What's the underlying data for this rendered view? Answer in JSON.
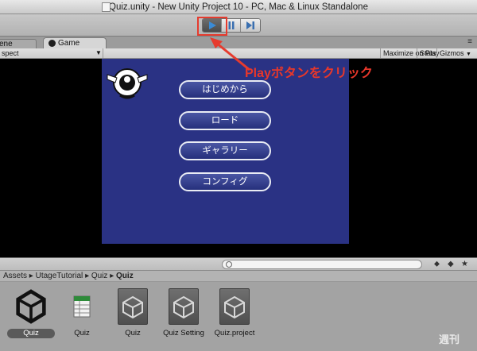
{
  "window": {
    "title": "Quiz.unity - New Unity Project 10 - PC, Mac & Linux Standalone"
  },
  "tabs": {
    "scene": "ene",
    "game": "Game"
  },
  "game_toolbar": {
    "aspect": "spect",
    "maximize": "Maximize on Play",
    "stats": "Stats",
    "gizmos": "Gizmos"
  },
  "annotation": {
    "text": "Playボタンをクリック"
  },
  "game_menu": {
    "buttons": [
      "はじめから",
      "ロード",
      "ギャラリー",
      "コンフィグ"
    ]
  },
  "project": {
    "breadcrumb": [
      "Assets",
      "UtageTutorial",
      "Quiz",
      "Quiz"
    ],
    "assets": [
      {
        "label": "Quiz",
        "kind": "unity-scene"
      },
      {
        "label": "Quiz",
        "kind": "spreadsheet"
      },
      {
        "label": "Quiz",
        "kind": "prefab"
      },
      {
        "label": "Quiz Setting",
        "kind": "prefab"
      },
      {
        "label": "Quiz.project",
        "kind": "prefab"
      }
    ]
  },
  "watermark": {
    "text": "週刊"
  },
  "colors": {
    "accent": "#e63b2e",
    "canvas": "#2a3284"
  }
}
